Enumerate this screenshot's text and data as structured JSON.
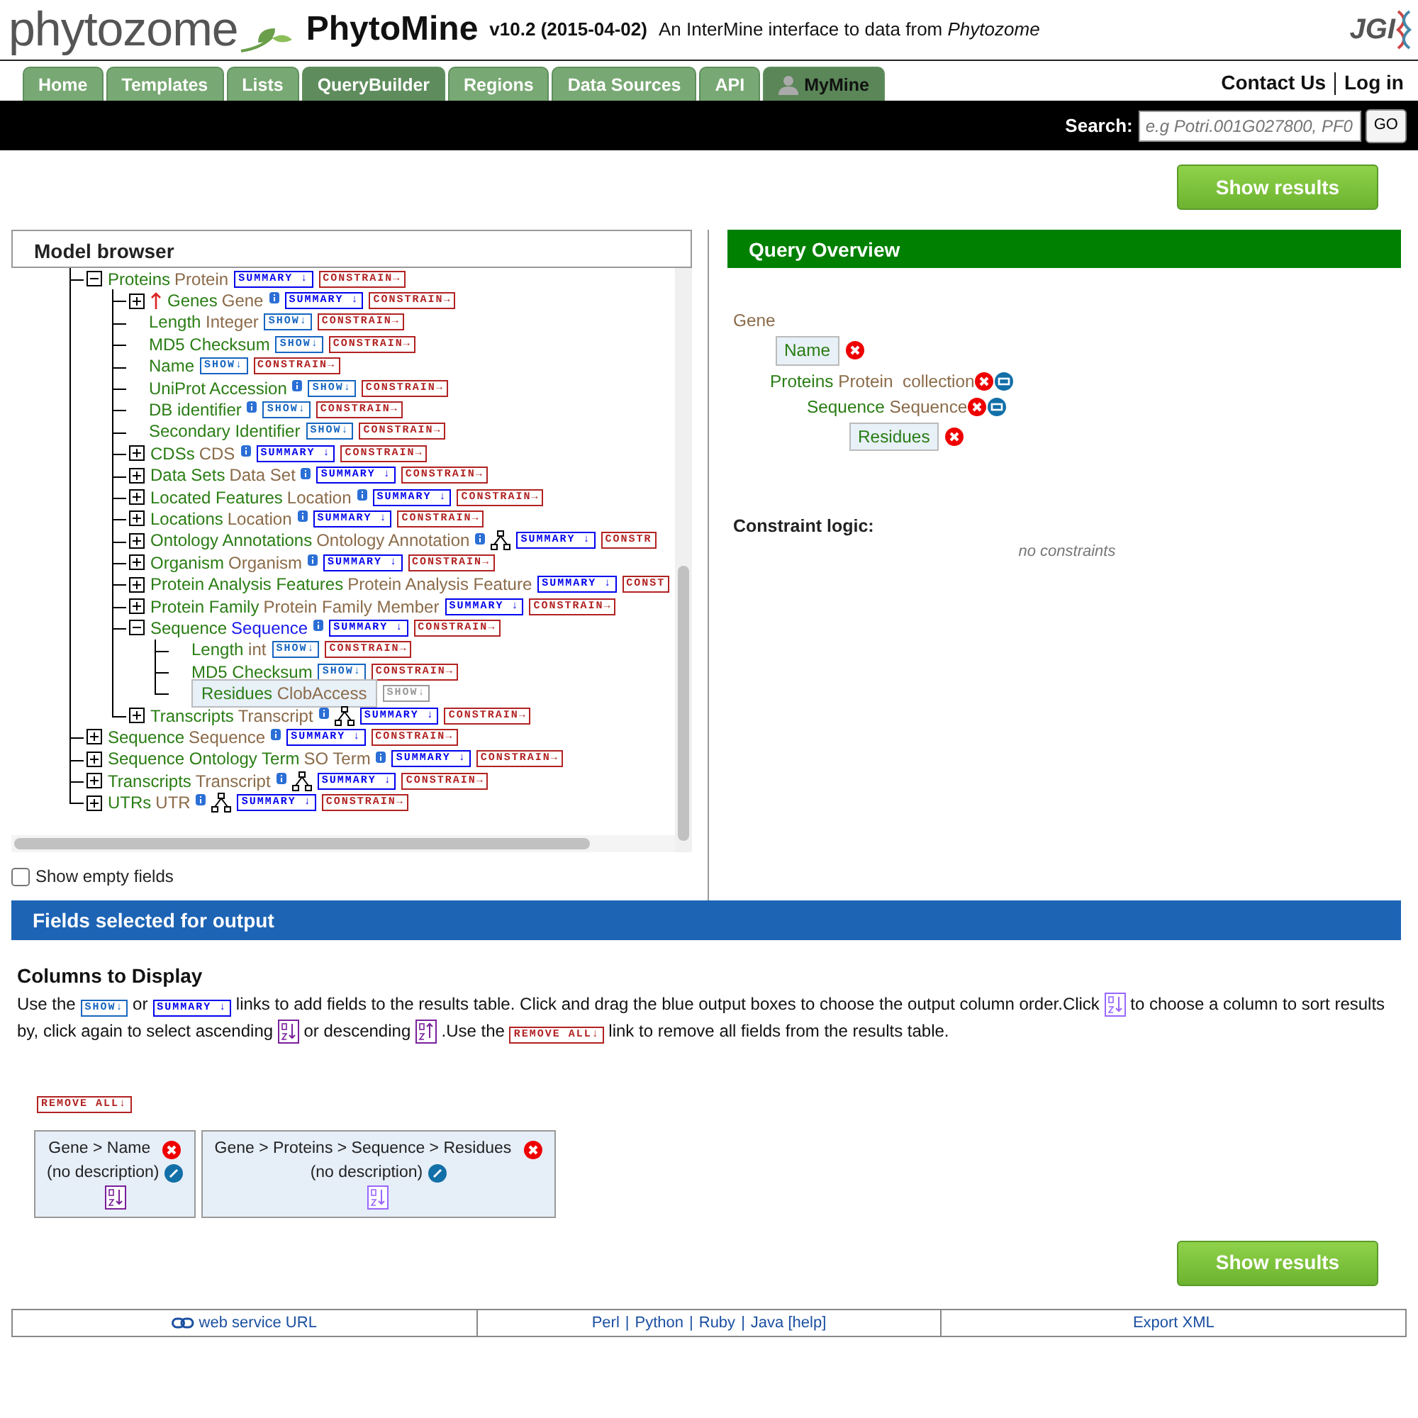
{
  "header": {
    "logo": "phytozome",
    "title": "PhytoMine",
    "version": "v10.2 (2015-04-02)",
    "tagline": "An InterMine interface to data from *Phytozome*",
    "partner_logo": "JGI"
  },
  "tabs": [
    {
      "label": "Home",
      "kind": "plain",
      "selected": false
    },
    {
      "label": "Templates",
      "kind": "plain",
      "selected": false
    },
    {
      "label": "Lists",
      "kind": "plain",
      "selected": false
    },
    {
      "label": "QueryBuilder",
      "kind": "plain",
      "selected": true
    },
    {
      "label": "Regions",
      "kind": "plain",
      "selected": false
    },
    {
      "label": "Data Sources",
      "kind": "plain",
      "selected": false
    },
    {
      "label": "API",
      "kind": "plain",
      "selected": false
    },
    {
      "label": "MyMine",
      "kind": "account",
      "selected": false
    }
  ],
  "top_links": [
    "Contact Us",
    "Log in"
  ],
  "search": {
    "label": "Search:",
    "placeholder": "e.g Potri.001G027800, PF0",
    "button": "GO"
  },
  "show_results_buttons": [
    "Show results",
    "Show results"
  ],
  "model_browser": {
    "title": "Model browser",
    "show_empty_fields": {
      "label": "Show empty fields",
      "checked": false
    },
    "tree": [
      {
        "name": "Proteins",
        "type": "Protein",
        "kind": "reference",
        "expanded": true,
        "reverse": false,
        "info": false,
        "subclasses": false,
        "selected": false,
        "buttons": [
          "SUMMARY ↓",
          "CONSTRAIN→"
        ],
        "children": [
          {
            "name": "Genes",
            "type": "Gene",
            "kind": "reference",
            "expanded": false,
            "reverse": true,
            "info": true,
            "subclasses": false,
            "selected": false,
            "buttons": [
              "SUMMARY ↓",
              "CONSTRAIN→"
            ]
          },
          {
            "name": "Length",
            "type": "Integer",
            "kind": "attribute",
            "info": false,
            "selected": false,
            "buttons": [
              "SHOW↓",
              "CONSTRAIN→"
            ]
          },
          {
            "name": "MD5 Checksum",
            "kind": "attribute",
            "info": false,
            "selected": false,
            "buttons": [
              "SHOW↓",
              "CONSTRAIN→"
            ]
          },
          {
            "name": "Name",
            "kind": "attribute",
            "info": false,
            "selected": false,
            "buttons": [
              "SHOW↓",
              "CONSTRAIN→"
            ]
          },
          {
            "name": "UniProt Accession",
            "kind": "attribute",
            "info": true,
            "selected": false,
            "buttons": [
              "SHOW↓",
              "CONSTRAIN→"
            ]
          },
          {
            "name": "DB identifier",
            "kind": "attribute",
            "info": true,
            "selected": false,
            "buttons": [
              "SHOW↓",
              "CONSTRAIN→"
            ]
          },
          {
            "name": "Secondary Identifier",
            "kind": "attribute",
            "info": false,
            "selected": false,
            "buttons": [
              "SHOW↓",
              "CONSTRAIN→"
            ]
          },
          {
            "name": "CDSs",
            "type": "CDS",
            "kind": "reference",
            "expanded": false,
            "reverse": false,
            "info": true,
            "subclasses": false,
            "selected": false,
            "buttons": [
              "SUMMARY ↓",
              "CONSTRAIN→"
            ]
          },
          {
            "name": "Data Sets",
            "type": "Data Set",
            "kind": "reference",
            "expanded": false,
            "reverse": false,
            "info": true,
            "subclasses": false,
            "selected": false,
            "buttons": [
              "SUMMARY ↓",
              "CONSTRAIN→"
            ]
          },
          {
            "name": "Located Features",
            "type": "Location",
            "kind": "reference",
            "expanded": false,
            "reverse": false,
            "info": true,
            "subclasses": false,
            "selected": false,
            "buttons": [
              "SUMMARY ↓",
              "CONSTRAIN→"
            ]
          },
          {
            "name": "Locations",
            "type": "Location",
            "kind": "reference",
            "expanded": false,
            "reverse": false,
            "info": true,
            "subclasses": false,
            "selected": false,
            "buttons": [
              "SUMMARY ↓",
              "CONSTRAIN→"
            ]
          },
          {
            "name": "Ontology Annotations",
            "type": "Ontology Annotation",
            "kind": "reference",
            "expanded": false,
            "reverse": false,
            "info": true,
            "subclasses": true,
            "selected": false,
            "buttons": [
              "SUMMARY ↓",
              "CONSTR"
            ]
          },
          {
            "name": "Organism",
            "type": "Organism",
            "kind": "reference",
            "expanded": false,
            "reverse": false,
            "info": true,
            "subclasses": false,
            "selected": false,
            "buttons": [
              "SUMMARY ↓",
              "CONSTRAIN→"
            ]
          },
          {
            "name": "Protein Analysis Features",
            "type": "Protein Analysis Feature",
            "kind": "reference",
            "expanded": false,
            "reverse": false,
            "info": false,
            "subclasses": false,
            "selected": false,
            "buttons": [
              "SUMMARY ↓",
              "CONST"
            ]
          },
          {
            "name": "Protein Family",
            "type": "Protein Family Member",
            "kind": "reference",
            "expanded": false,
            "reverse": false,
            "info": false,
            "subclasses": false,
            "selected": false,
            "buttons": [
              "SUMMARY ↓",
              "CONSTRAIN→"
            ]
          },
          {
            "name": "Sequence",
            "type": "Sequence",
            "kind": "reference",
            "expanded": true,
            "reverse": false,
            "info": true,
            "subclasses": false,
            "selected": true,
            "buttons": [
              "SUMMARY ↓",
              "CONSTRAIN→"
            ],
            "children": [
              {
                "name": "Length",
                "type": "int",
                "kind": "attribute",
                "info": false,
                "selected": false,
                "buttons": [
                  "SHOW↓",
                  "CONSTRAIN→"
                ]
              },
              {
                "name": "MD5 Checksum",
                "kind": "attribute",
                "info": false,
                "selected": false,
                "buttons": [
                  "SHOW↓",
                  "CONSTRAIN→"
                ]
              },
              {
                "name": "Residues",
                "type": "ClobAccess",
                "kind": "attribute",
                "info": false,
                "selected": true,
                "buttons": [
                  "SHOW↓"
                ]
              }
            ]
          },
          {
            "name": "Transcripts",
            "type": "Transcript",
            "kind": "reference",
            "expanded": false,
            "reverse": false,
            "info": true,
            "subclasses": true,
            "selected": false,
            "buttons": [
              "SUMMARY ↓",
              "CONSTRAIN→"
            ]
          }
        ]
      },
      {
        "name": "Sequence",
        "type": "Sequence",
        "kind": "reference",
        "expanded": false,
        "reverse": false,
        "info": true,
        "subclasses": false,
        "selected": false,
        "buttons": [
          "SUMMARY ↓",
          "CONSTRAIN→"
        ]
      },
      {
        "name": "Sequence Ontology Term",
        "type": "SO Term",
        "kind": "reference",
        "expanded": false,
        "reverse": false,
        "info": true,
        "subclasses": false,
        "selected": false,
        "buttons": [
          "SUMMARY ↓",
          "CONSTRAIN→"
        ]
      },
      {
        "name": "Transcripts",
        "type": "Transcript",
        "kind": "reference",
        "expanded": false,
        "reverse": false,
        "info": true,
        "subclasses": true,
        "selected": false,
        "buttons": [
          "SUMMARY ↓",
          "CONSTRAIN→"
        ]
      },
      {
        "name": "UTRs",
        "type": "UTR",
        "kind": "reference",
        "expanded": false,
        "reverse": false,
        "info": true,
        "subclasses": true,
        "selected": false,
        "buttons": [
          "SUMMARY ↓",
          "CONSTRAIN→"
        ]
      }
    ]
  },
  "query_overview": {
    "title": "Query Overview",
    "tree": {
      "name": "Gene",
      "kind": "root",
      "children": [
        {
          "name": "Name",
          "kind": "attribute"
        },
        {
          "name": "Proteins",
          "type": "Protein",
          "note": "collection",
          "kind": "reference",
          "children": [
            {
              "name": "Sequence",
              "type": "Sequence",
              "kind": "reference",
              "children": [
                {
                  "name": "Residues",
                  "kind": "attribute"
                }
              ]
            }
          ]
        }
      ]
    },
    "constraint_logic": {
      "label": "Constraint logic:",
      "value": "no constraints"
    }
  },
  "output": {
    "title": "Fields selected for output",
    "heading": "Columns to Display",
    "help": [
      {
        "kind": "text",
        "text": "Use the"
      },
      {
        "kind": "show",
        "text": "SHOW↓"
      },
      {
        "kind": "text",
        "text": "or"
      },
      {
        "kind": "summary",
        "text": "SUMMARY ↓"
      },
      {
        "kind": "text",
        "text": "links to add fields to the results table. Click and drag the blue output boxes to choose the output column order.Click"
      },
      {
        "kind": "sort"
      },
      {
        "kind": "text",
        "text": "to choose a column to sort results by, click again to select ascending"
      },
      {
        "kind": "sort-asc"
      },
      {
        "kind": "text",
        "text": "or descending"
      },
      {
        "kind": "sort-desc"
      },
      {
        "kind": "text",
        "text": ".Use the"
      },
      {
        "kind": "remove",
        "text": "REMOVE ALL↓"
      },
      {
        "kind": "text",
        "text": "link to remove all fields from the results table."
      }
    ],
    "remove_all": "REMOVE ALL↓",
    "columns": [
      {
        "path": "Gene > Name",
        "description": "(no description)",
        "sort_active": true
      },
      {
        "path": "Gene > Proteins > Sequence > Residues",
        "description": "(no description)",
        "sort_active": false
      }
    ]
  },
  "footer": [
    [
      {
        "kind": "icon-link",
        "text": "web service URL"
      }
    ],
    [
      {
        "kind": "link",
        "text": "Perl"
      },
      {
        "kind": "sep",
        "text": "|"
      },
      {
        "kind": "link",
        "text": "Python"
      },
      {
        "kind": "sep",
        "text": "|"
      },
      {
        "kind": "link",
        "text": "Ruby"
      },
      {
        "kind": "sep",
        "text": "|"
      },
      {
        "kind": "link",
        "text": "Java"
      },
      {
        "kind": "link",
        "text": "[help]"
      }
    ],
    [
      {
        "kind": "link",
        "text": "Export XML"
      }
    ]
  ]
}
